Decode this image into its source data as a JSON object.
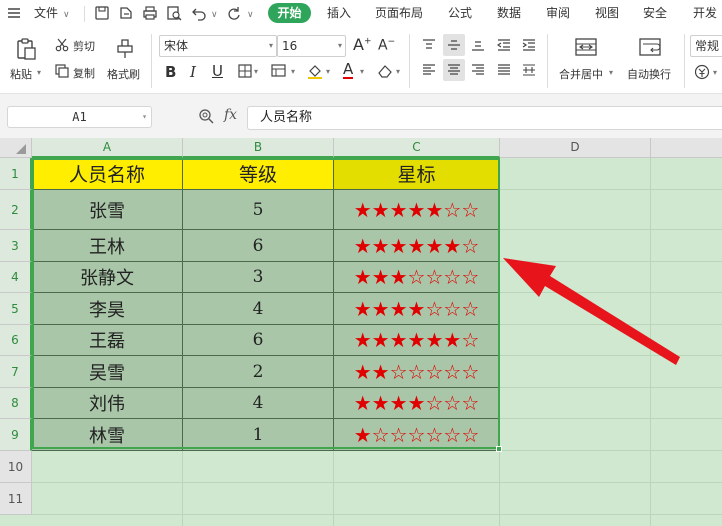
{
  "menubar": {
    "file_label": "文件",
    "tabs": [
      "开始",
      "插入",
      "页面布局",
      "公式",
      "数据",
      "审阅",
      "视图",
      "安全",
      "开发"
    ]
  },
  "ribbon": {
    "paste": "粘贴",
    "cut": "剪切",
    "copy": "复制",
    "format_painter": "格式刷",
    "font_name": "宋体",
    "font_size": "16",
    "merge_center": "合并居中",
    "wrap_text": "自动换行",
    "number_format": "常规"
  },
  "formula_bar": {
    "name_box": "A1",
    "fx": "fx",
    "content": "人员名称"
  },
  "grid": {
    "columns": [
      "A",
      "B",
      "C",
      "D"
    ],
    "rows": [
      "1",
      "2",
      "3",
      "4",
      "5",
      "6",
      "7",
      "8",
      "9",
      "10",
      "11"
    ]
  },
  "table": {
    "headers": [
      "人员名称",
      "等级",
      "星标"
    ],
    "rows": [
      {
        "name": "张雪",
        "level": "5",
        "stars": "★★★★★☆☆"
      },
      {
        "name": "王林",
        "level": "6",
        "stars": "★★★★★★☆"
      },
      {
        "name": "张静文",
        "level": "3",
        "stars": "★★★☆☆☆☆"
      },
      {
        "name": "李昊",
        "level": "4",
        "stars": "★★★★☆☆☆"
      },
      {
        "name": "王磊",
        "level": "6",
        "stars": "★★★★★★☆"
      },
      {
        "name": "吴雪",
        "level": "2",
        "stars": "★★☆☆☆☆☆"
      },
      {
        "name": "刘伟",
        "level": "4",
        "stars": "★★★★☆☆☆"
      },
      {
        "name": "林雪",
        "level": "1",
        "stars": "★☆☆☆☆☆☆"
      }
    ]
  },
  "colors": {
    "accent": "#2ea55b",
    "header_fill": "#ffee00",
    "body_fill": "#a9c7a8",
    "star": "#e00000",
    "arrow": "#e8141b"
  }
}
